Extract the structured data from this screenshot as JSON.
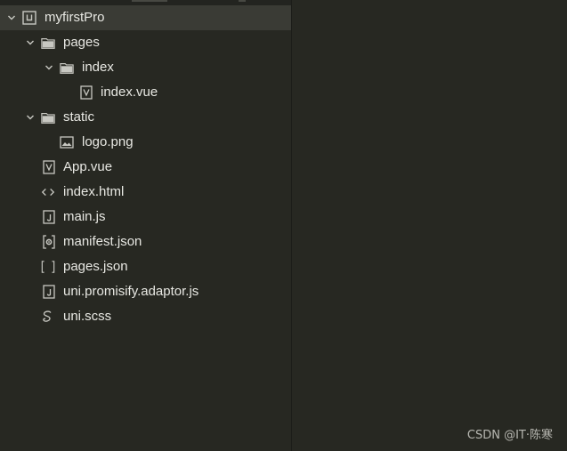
{
  "project": {
    "name": "myfirstPro"
  },
  "tree": {
    "pages": "pages",
    "index_folder": "index",
    "index_vue": "index.vue",
    "static": "static",
    "logo": "logo.png",
    "app_vue": "App.vue",
    "index_html": "index.html",
    "main_js": "main.js",
    "manifest": "manifest.json",
    "pages_json": "pages.json",
    "promisify": "uni.promisify.adaptor.js",
    "scss": "uni.scss"
  },
  "watermark": "CSDN @IT·陈寒",
  "colors": {
    "background": "#272822",
    "selected_row": "#3a3b35",
    "text": "#e8e8e3",
    "icon": "#c8c8c2"
  },
  "icons": {
    "chevron": "chevron-down-icon",
    "project": "project-icon",
    "folder": "folder-icon",
    "vue": "vue-file-icon",
    "image": "image-file-icon",
    "html": "html-file-icon",
    "js": "js-file-icon",
    "json_settings": "json-settings-icon",
    "json": "json-file-icon",
    "scss": "scss-file-icon"
  }
}
